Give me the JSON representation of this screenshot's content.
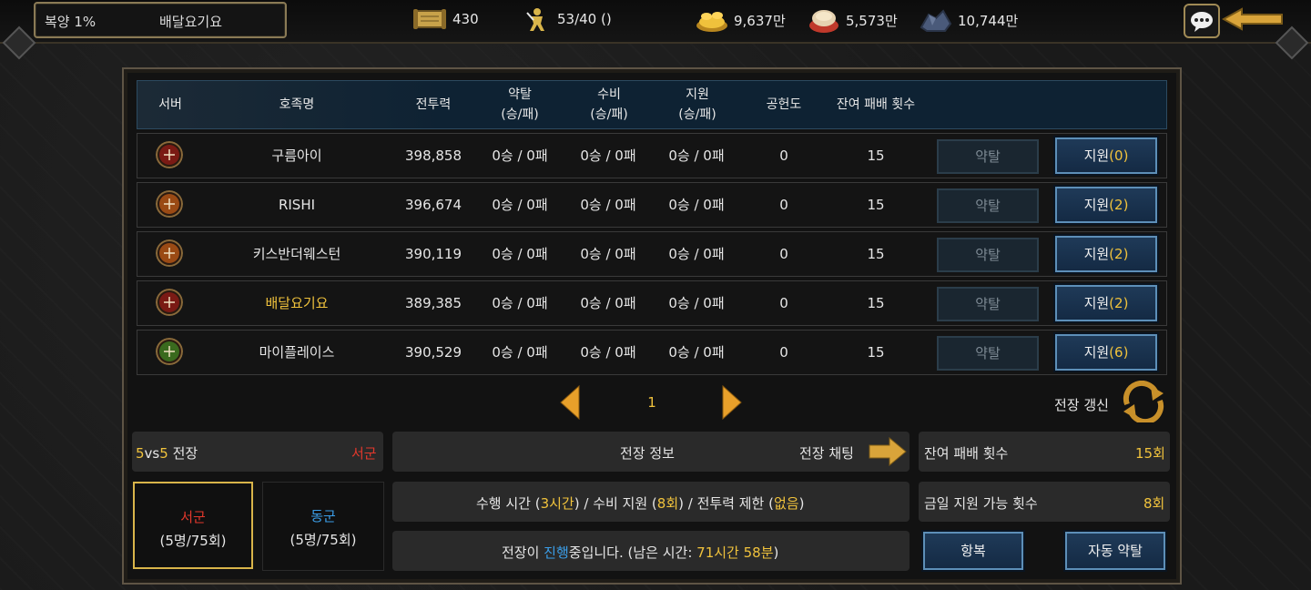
{
  "topbar": {
    "status_label": "복양 1%",
    "clan_name": "배달요기요",
    "scroll_count": "430",
    "stamina": "53/40 ()",
    "gold": "9,637만",
    "food": "5,573만",
    "ore": "10,744만"
  },
  "table": {
    "headers": {
      "server": "서버",
      "clan": "호족명",
      "power": "전투력",
      "plunder": "약탈",
      "plunder_sub": "(승/패)",
      "defense": "수비",
      "defense_sub": "(승/패)",
      "support": "지원",
      "support_sub": "(승/패)",
      "contribution": "공헌도",
      "remaining": "잔여 패배 횟수"
    },
    "rows": [
      {
        "name": "구름아이",
        "power": "398,858",
        "plunder": "0승 / 0패",
        "defense": "0승 / 0패",
        "support": "0승 / 0패",
        "contribution": "0",
        "remaining": "15",
        "plunder_btn": "약탈",
        "support_btn": "지원",
        "support_count": "(0)",
        "emblem_color": "#7a1a14",
        "highlight": false
      },
      {
        "name": "RISHI",
        "power": "396,674",
        "plunder": "0승 / 0패",
        "defense": "0승 / 0패",
        "support": "0승 / 0패",
        "contribution": "0",
        "remaining": "15",
        "plunder_btn": "약탈",
        "support_btn": "지원",
        "support_count": "(2)",
        "emblem_color": "#9a4a14",
        "highlight": false
      },
      {
        "name": "키스반더웨스턴",
        "power": "390,119",
        "plunder": "0승 / 0패",
        "defense": "0승 / 0패",
        "support": "0승 / 0패",
        "contribution": "0",
        "remaining": "15",
        "plunder_btn": "약탈",
        "support_btn": "지원",
        "support_count": "(2)",
        "emblem_color": "#9a4a14",
        "highlight": false
      },
      {
        "name": "배달요기요",
        "power": "389,385",
        "plunder": "0승 / 0패",
        "defense": "0승 / 0패",
        "support": "0승 / 0패",
        "contribution": "0",
        "remaining": "15",
        "plunder_btn": "약탈",
        "support_btn": "지원",
        "support_count": "(2)",
        "emblem_color": "#7a1a14",
        "highlight": true
      },
      {
        "name": "마이플레이스",
        "power": "390,529",
        "plunder": "0승 / 0패",
        "defense": "0승 / 0패",
        "support": "0승 / 0패",
        "contribution": "0",
        "remaining": "15",
        "plunder_btn": "약탈",
        "support_btn": "지원",
        "support_count": "(6)",
        "emblem_color": "#3a6a1e",
        "highlight": false
      }
    ]
  },
  "pager": {
    "page": "1"
  },
  "refresh_label": "전장 갱신",
  "battle": {
    "mode_a": "5",
    "mode_vs": "vs",
    "mode_b": "5",
    "mode_suffix": " 전장",
    "team_side": "서군",
    "info_label": "전장 정보",
    "chat_label": "전장 채팅",
    "remaining_label": "잔여 패배 횟수",
    "remaining_value": "15회",
    "daily_label": "금일 지원 가능 횟수",
    "daily_value": "8회",
    "rule_p1": "수행 시간 (",
    "rule_time": "3시간",
    "rule_p2": ") / 수비 지원 (",
    "rule_support": "8회",
    "rule_p3": ") / 전투력 제한 (",
    "rule_limit": "없음",
    "rule_p4": ")",
    "status_p1": "전장이 ",
    "status_active": "진행",
    "status_p2": "중입니다. (남은 시간: ",
    "status_time": "71시간 58분",
    "status_p3": ")"
  },
  "armies": {
    "west_name": "서군",
    "west_count": "(5명/75회)",
    "east_name": "동군",
    "east_count": "(5명/75회)"
  },
  "actions": {
    "surrender": "항복",
    "auto_plunder": "자동 약탈"
  }
}
